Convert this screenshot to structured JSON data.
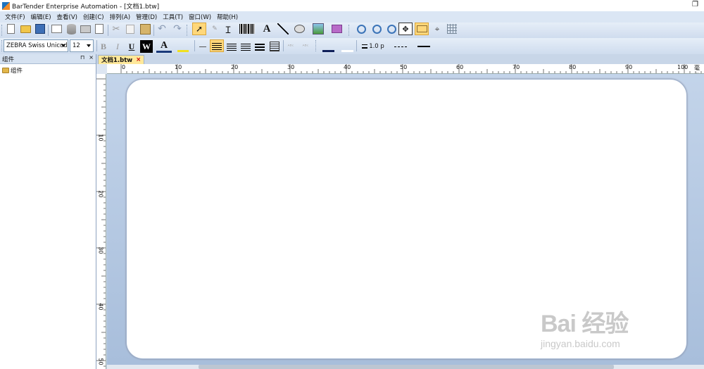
{
  "window": {
    "title": "BarTender Enterprise Automation - [文档1.btw]",
    "restore_glyph": "❐",
    "min_glyph": "—"
  },
  "menu": [
    "文件(F)",
    "编辑(E)",
    "查看(V)",
    "创建(C)",
    "排列(A)",
    "管理(D)",
    "工具(T)",
    "窗口(W)",
    "帮助(H)"
  ],
  "toolbar": {
    "font_name": "ZEBRA Swiss Unicod",
    "font_size": "12",
    "bold": "B",
    "italic": "I",
    "underline": "U",
    "reverse": "W",
    "font_color": "A",
    "text_tool": "A",
    "line_width": "1.0 p"
  },
  "panel": {
    "title": "组件",
    "pin": "⊓",
    "close": "×",
    "tree_item": "组件"
  },
  "doc_tab": {
    "label": "文档1.btw",
    "close": "×"
  },
  "ruler": {
    "h_labels": [
      "0",
      "10",
      "20",
      "30",
      "40",
      "50",
      "60",
      "70",
      "80",
      "90",
      "100"
    ],
    "h_unit": "毫米",
    "v_labels": [
      "10",
      "20",
      "30",
      "40",
      "50"
    ]
  },
  "watermark": {
    "brand": "Bai 经验",
    "url": "jingyan.baidu.com"
  },
  "colors": {
    "accent": "#f28c28",
    "brand": "#1e73be",
    "tab_active": "#ffe89a"
  }
}
